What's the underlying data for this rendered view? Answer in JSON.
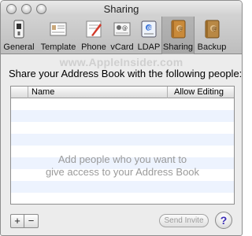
{
  "window": {
    "title": "Sharing"
  },
  "toolbar": {
    "items": [
      {
        "label": "General",
        "icon": "general-prefs-icon"
      },
      {
        "label": "Template",
        "icon": "template-card-icon"
      },
      {
        "label": "Phone",
        "icon": "phone-format-icon"
      },
      {
        "label": "vCard",
        "icon": "vcard-icon"
      },
      {
        "label": "LDAP",
        "icon": "ldap-server-icon"
      },
      {
        "label": "Sharing",
        "icon": "sharing-book-icon",
        "selected": true
      },
      {
        "label": "Backup",
        "icon": "backup-book-icon"
      }
    ]
  },
  "watermark": "www.AppleInsider.com",
  "instruction": "Share your Address Book with the following people:",
  "table": {
    "columns": [
      "Name",
      "Allow Editing"
    ],
    "empty_message_line1": "Add people who you want to",
    "empty_message_line2": "give access to your Address Book"
  },
  "bottom": {
    "add_label": "+",
    "remove_label": "−",
    "send_invite_label": "Send Invite",
    "help_label": "?"
  },
  "colors": {
    "window_bg": "#ececec",
    "row_alt": "#edf3fe",
    "help_glyph": "#3a2bb5",
    "sharing_book": "#c98a3a"
  }
}
